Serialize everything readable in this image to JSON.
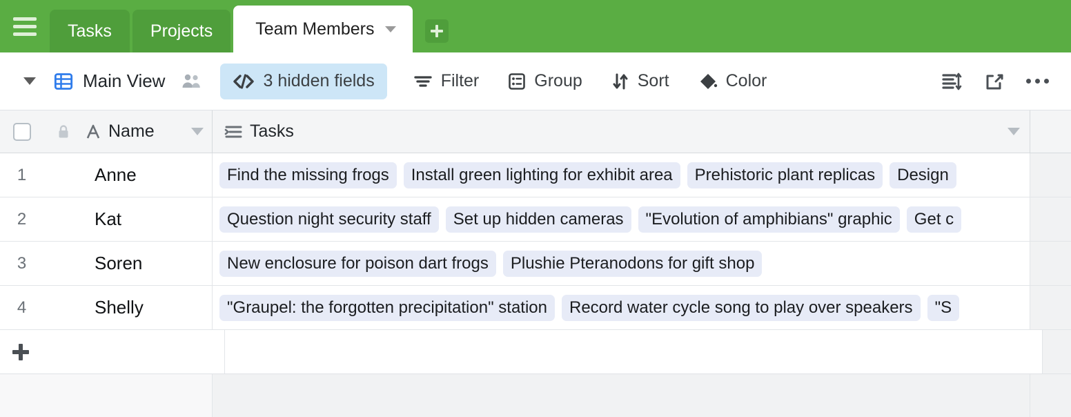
{
  "tabbar": {
    "menu_icon": "hamburger-icon",
    "add_tab_icon": "plus-icon",
    "tabs": [
      {
        "label": "Tasks",
        "active": false
      },
      {
        "label": "Projects",
        "active": false
      },
      {
        "label": "Team Members",
        "active": true
      }
    ]
  },
  "toolbar": {
    "view_caret_icon": "chevron-down-icon",
    "view_icon": "grid-view-icon",
    "view_name": "Main View",
    "collaborators_icon": "people-icon",
    "hidden_fields": {
      "icon": "code-brackets-icon",
      "label": "3 hidden fields"
    },
    "filter": {
      "icon": "filter-icon",
      "label": "Filter"
    },
    "group": {
      "icon": "group-icon",
      "label": "Group"
    },
    "sort": {
      "icon": "sort-arrows-icon",
      "label": "Sort"
    },
    "color": {
      "icon": "paint-bucket-icon",
      "label": "Color"
    },
    "row_height": {
      "icon": "row-height-icon"
    },
    "share": {
      "icon": "share-external-icon"
    },
    "more": {
      "icon": "ellipsis-icon"
    }
  },
  "grid": {
    "select_all_checkbox": "",
    "columns": [
      {
        "name": "Name",
        "icon": "text-field-icon",
        "lock_icon": "lock-icon",
        "caret": "chevron-down-icon"
      },
      {
        "name": "Tasks",
        "icon": "linked-record-icon",
        "caret": "chevron-down-icon"
      }
    ],
    "rows": [
      {
        "num": "1",
        "name": "Anne",
        "tasks": [
          "Find the missing frogs",
          "Install green lighting for exhibit area",
          "Prehistoric plant replicas",
          "Design "
        ]
      },
      {
        "num": "2",
        "name": "Kat",
        "tasks": [
          "Question night security staff",
          "Set up hidden cameras",
          "\"Evolution of amphibians\" graphic",
          "Get c"
        ]
      },
      {
        "num": "3",
        "name": "Soren",
        "tasks": [
          "New enclosure for poison dart frogs",
          "Plushie Pteranodons for gift shop"
        ]
      },
      {
        "num": "4",
        "name": "Shelly",
        "tasks": [
          "\"Graupel: the forgotten precipitation\" station",
          "Record water cycle song to play over speakers",
          "\"S"
        ]
      }
    ],
    "add_row_icon": "plus-icon"
  },
  "colors": {
    "tabbar_green": "#5aad43",
    "tab_inactive_green": "#4f9e3b",
    "hidden_pill_blue": "#cde6f7",
    "chip_bg": "#e7ebf7",
    "grid_line": "#e2e5e8"
  }
}
